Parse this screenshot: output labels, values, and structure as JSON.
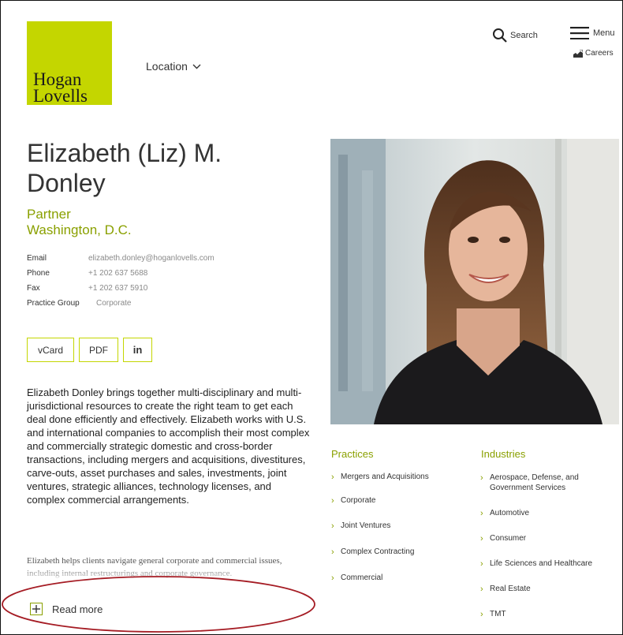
{
  "header": {
    "logo_line1": "Hogan",
    "logo_line2": "Lovells",
    "location_label": "Location",
    "search_label": "Search",
    "menu_label": "Menu",
    "careers_label": "Careers"
  },
  "profile": {
    "name": "Elizabeth (Liz) M. Donley",
    "title": "Partner",
    "office": "Washington, D.C.",
    "contact": [
      {
        "key": "Email",
        "value": "elizabeth.donley@hoganlovells.com"
      },
      {
        "key": "Phone",
        "value": "+1 202 637 5688"
      },
      {
        "key": "Fax",
        "value": "+1 202 637 5910"
      }
    ],
    "practice_group_label": "Practice Group",
    "practice_group_value": "Corporate",
    "buttons": {
      "vcard": "vCard",
      "pdf": "PDF",
      "linkedin": "in"
    },
    "bio": "Elizabeth Donley brings together multi-disciplinary and multi-jurisdictional resources to create the right team to get each deal done efficiently and effectively. Elizabeth works with U.S. and international companies to accomplish their most complex and commercially strategic domestic and cross-border transactions, including mergers and acquisitions, divestitures, carve-outs, asset purchases and sales, investments, joint ventures, strategic alliances, technology licenses, and complex commercial arrangements.",
    "bio_more": "Elizabeth helps clients navigate general corporate and commercial issues, including internal restructurings and corporate governance.",
    "read_more_label": "Read more"
  },
  "practices": {
    "heading": "Practices",
    "items": [
      "Mergers and Acquisitions",
      "Corporate",
      "Joint Ventures",
      "Complex Contracting",
      "Commercial"
    ]
  },
  "industries": {
    "heading": "Industries",
    "items": [
      "Aerospace, Defense, and Government Services",
      "Automotive",
      "Consumer",
      "Life Sciences and Healthcare",
      "Real Estate",
      "TMT"
    ]
  },
  "colors": {
    "brand": "#c4d600",
    "accent_text": "#8aa000",
    "annotation": "#a51c24"
  }
}
